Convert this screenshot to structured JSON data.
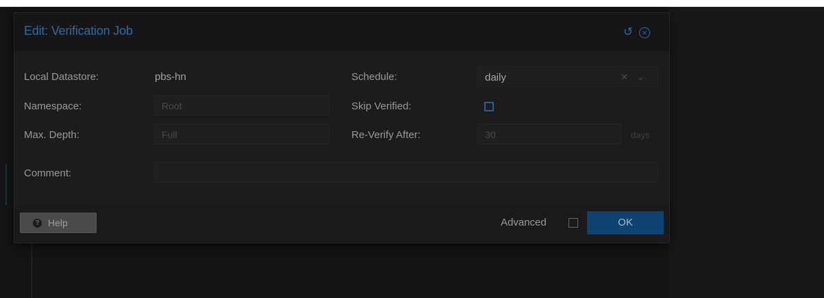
{
  "dialog": {
    "title": "Edit: Verification Job",
    "icons": {
      "reset": "reset-icon",
      "close": "close-icon"
    }
  },
  "fields": {
    "datastore": {
      "label": "Local Datastore:",
      "value": "pbs-hn"
    },
    "namespace": {
      "label": "Namespace:",
      "value": "Root"
    },
    "max_depth": {
      "label": "Max. Depth:",
      "value": "Full"
    },
    "comment": {
      "label": "Comment:",
      "value": ""
    },
    "schedule": {
      "label": "Schedule:",
      "value": "daily"
    },
    "skip_verified": {
      "label": "Skip Verified:",
      "checked": false
    },
    "reverify_after": {
      "label": "Re-Verify After:",
      "value": "30",
      "unit": "days"
    }
  },
  "footer": {
    "help_label": "Help",
    "advanced_label": "Advanced",
    "advanced_checked": false,
    "ok_label": "OK"
  },
  "colors": {
    "accent": "#2f6aa3",
    "ok_button": "#0f4470",
    "dialog_bg": "#1c1c1c"
  }
}
